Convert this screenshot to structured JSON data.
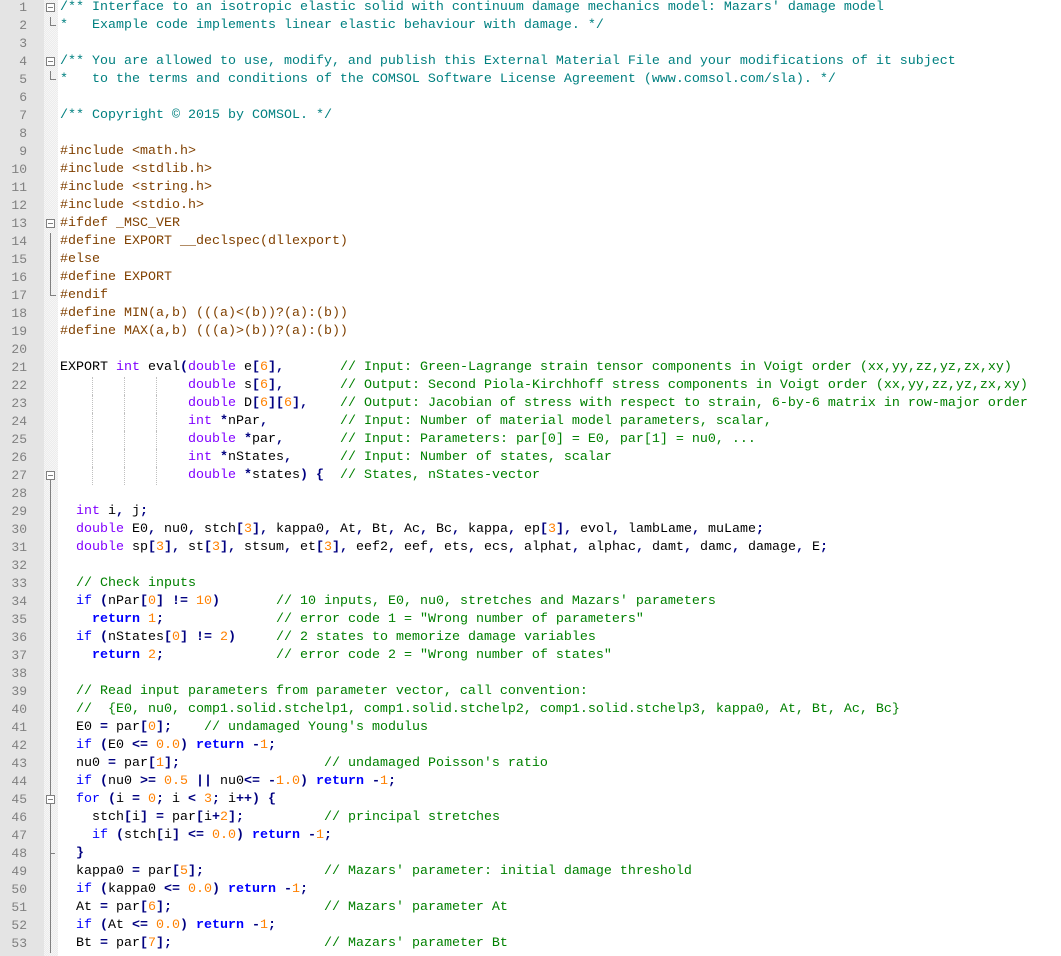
{
  "editor": {
    "language": "C",
    "colors": {
      "doc_comment": "#008080",
      "line_comment": "#008000",
      "preprocessor": "#804000",
      "type": "#8000FF",
      "keyword": "#0000FF",
      "number": "#FF8000",
      "operator": "#000080"
    },
    "lines": [
      "/** Interface to an isotropic elastic solid with continuum damage mechanics model: Mazars' damage model",
      "*   Example code implements linear elastic behaviour with damage. */",
      "",
      "/** You are allowed to use, modify, and publish this External Material File and your modifications of it subject",
      "*   to the terms and conditions of the COMSOL Software License Agreement (www.comsol.com/sla). */",
      "",
      "/** Copyright © 2015 by COMSOL. */",
      "",
      "#include <math.h>",
      "#include <stdlib.h>",
      "#include <string.h>",
      "#include <stdio.h>",
      "#ifdef _MSC_VER",
      "#define EXPORT __declspec(dllexport)",
      "#else",
      "#define EXPORT",
      "#endif",
      "#define MIN(a,b) (((a)<(b))?(a):(b))",
      "#define MAX(a,b) (((a)>(b))?(a):(b))",
      "",
      "EXPORT int eval(double e[6],       // Input: Green-Lagrange strain tensor components in Voigt order (xx,yy,zz,yz,zx,xy)",
      "                double s[6],       // Output: Second Piola-Kirchhoff stress components in Voigt order (xx,yy,zz,yz,zx,xy)",
      "                double D[6][6],    // Output: Jacobian of stress with respect to strain, 6-by-6 matrix in row-major order",
      "                int *nPar,         // Input: Number of material model parameters, scalar,",
      "                double *par,       // Input: Parameters: par[0] = E0, par[1] = nu0, ...",
      "                int *nStates,      // Input: Number of states, scalar",
      "                double *states) {  // States, nStates-vector",
      "",
      "  int i, j;",
      "  double E0, nu0, stch[3], kappa0, At, Bt, Ac, Bc, kappa, ep[3], evol, lambLame, muLame;",
      "  double sp[3], st[3], stsum, et[3], eef2, eef, ets, ecs, alphat, alphac, damt, damc, damage, E;",
      "",
      "  // Check inputs",
      "  if (nPar[0] != 10)       // 10 inputs, E0, nu0, stretches and Mazars' parameters",
      "    return 1;              // error code 1 = \"Wrong number of parameters\"",
      "  if (nStates[0] != 2)     // 2 states to memorize damage variables",
      "    return 2;              // error code 2 = \"Wrong number of states\"",
      "",
      "  // Read input parameters from parameter vector, call convention:",
      "  //  {E0, nu0, comp1.solid.stchelp1, comp1.solid.stchelp2, comp1.solid.stchelp3, kappa0, At, Bt, Ac, Bc}",
      "  E0 = par[0];    // undamaged Young's modulus",
      "  if (E0 <= 0.0) return -1;",
      "  nu0 = par[1];                  // undamaged Poisson's ratio",
      "  if (nu0 >= 0.5 || nu0<= -1.0) return -1;",
      "  for (i = 0; i < 3; i++) {",
      "    stch[i] = par[i+2];          // principal stretches",
      "    if (stch[i] <= 0.0) return -1;",
      "  }",
      "  kappa0 = par[5];               // Mazars' parameter: initial damage threshold",
      "  if (kappa0 <= 0.0) return -1;",
      "  At = par[6];                   // Mazars' parameter At",
      "  if (At <= 0.0) return -1;",
      "  Bt = par[7];                   // Mazars' parameter Bt"
    ]
  }
}
